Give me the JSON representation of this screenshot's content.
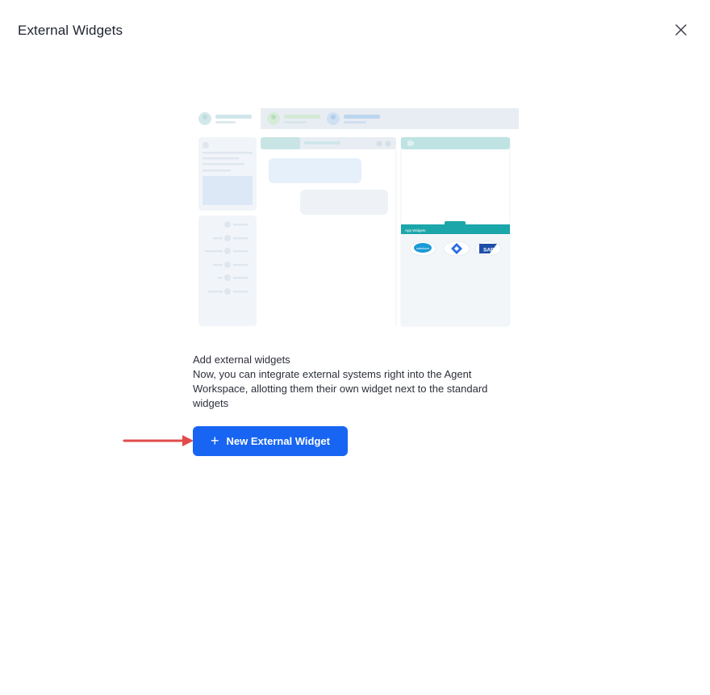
{
  "header": {
    "title": "External Widgets",
    "close_icon": "close-icon"
  },
  "illustration": {
    "app_widgets_label": "App Widgets",
    "logos": [
      "salesforce-logo",
      "jira-logo",
      "sap-logo"
    ],
    "salesforce_text": "salesforce",
    "sap_text": "SAP"
  },
  "empty_state": {
    "heading": "Add external widgets",
    "description": "Now, you can integrate external systems right into the Agent Workspace, allotting them their own widget next to the standard widgets"
  },
  "actions": {
    "new_widget_label": "New External Widget",
    "new_widget_icon": "plus-icon"
  },
  "colors": {
    "primary": "#1765f2",
    "teal": "#1ba6a9",
    "annotation_arrow": "#e24b4b"
  }
}
